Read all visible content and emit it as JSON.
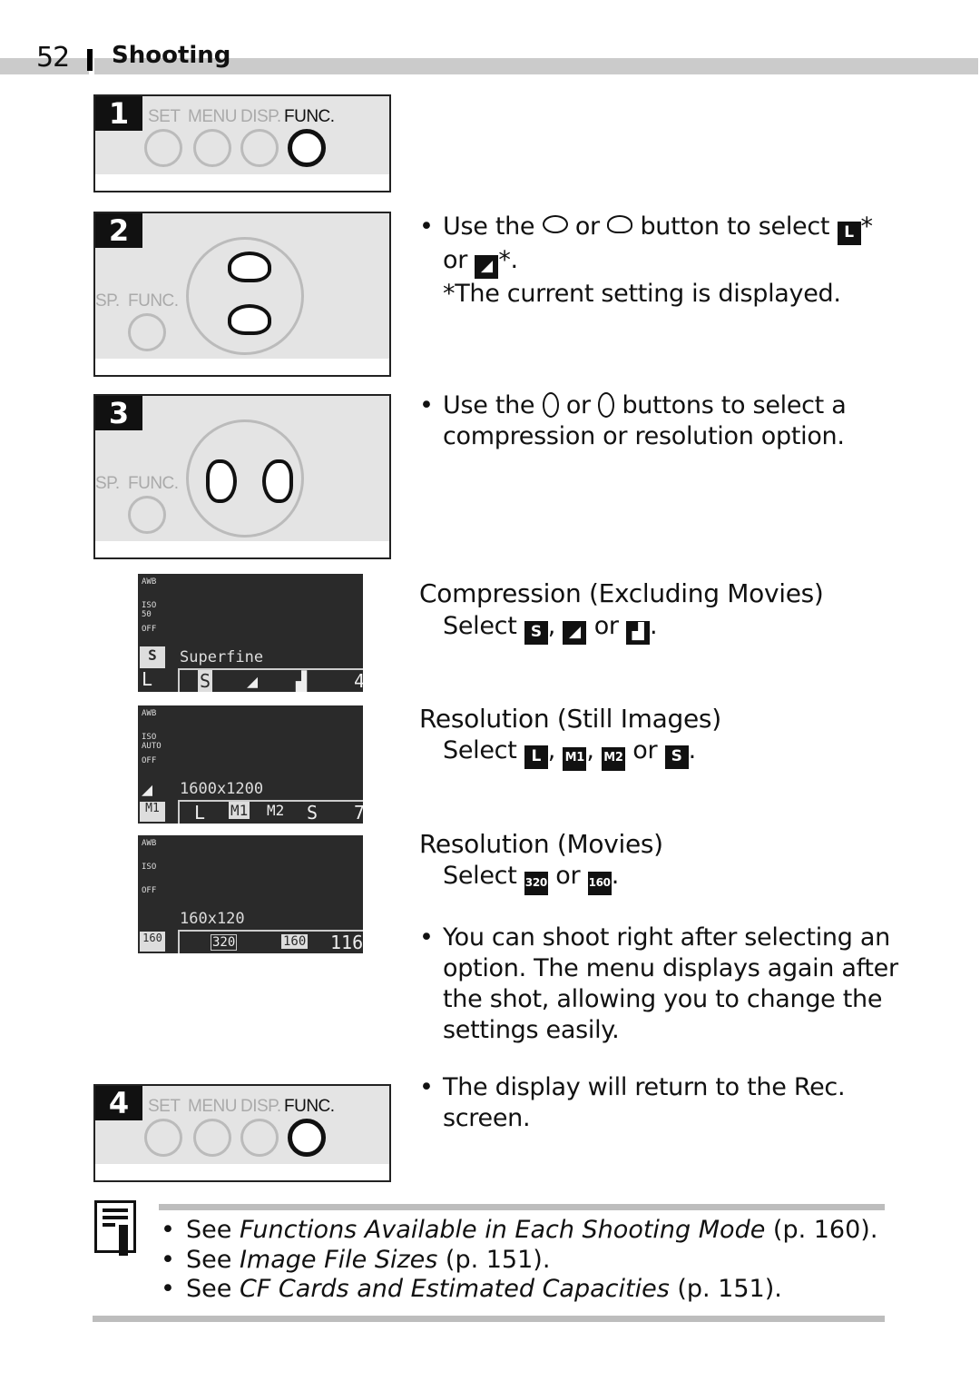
{
  "header": {
    "page_number": "52",
    "section": "Shooting"
  },
  "colors": {
    "header_bar": "#cbcbcb",
    "lcd_bg": "#2a2a2a",
    "text": "#111111"
  },
  "steps": [
    {
      "number": "1",
      "buttons": [
        "SET",
        "MENU",
        "DISP.",
        "FUNC."
      ],
      "active_button": "FUNC."
    },
    {
      "number": "2",
      "labels": [
        "SP.",
        "FUNC."
      ],
      "highlight": "up-down-buttons",
      "text_prefix": "Use the",
      "text_or": "or",
      "text_mid": "button to select",
      "glyph1": "L",
      "star": "*",
      "line2_or": "or",
      "line2_star": "*.",
      "note": "*The current setting is displayed."
    },
    {
      "number": "3",
      "labels": [
        "SP.",
        "FUNC."
      ],
      "highlight": "left-right-buttons",
      "text_prefix": "Use the",
      "text_or": "or",
      "text_rest": "buttons to select a",
      "line2": "compression or resolution option."
    },
    {
      "number": "4",
      "buttons": [
        "SET",
        "MENU",
        "DISP.",
        "FUNC."
      ],
      "active_button": "FUNC.",
      "text_line1": "The display will return to the Rec.",
      "text_line2": "screen."
    }
  ],
  "screens": [
    {
      "left_icons": [
        "AWB",
        "ISO 50",
        "OFF"
      ],
      "caption": "Superfine",
      "corner": "L",
      "options": [
        "S",
        "◢",
        "▟"
      ],
      "count": "4"
    },
    {
      "left_icons": [
        "AWB",
        "ISO AUTO",
        "OFF"
      ],
      "caption": "1600x1200",
      "corner": "M1",
      "options": [
        "L",
        "M1",
        "M2",
        "S"
      ],
      "count": "7"
    },
    {
      "left_icons": [
        "AWB",
        "ISO",
        "OFF"
      ],
      "caption": "160x120",
      "corner": "160",
      "options": [
        "320",
        "160"
      ],
      "count": "116\""
    }
  ],
  "sections": {
    "compression": {
      "heading": "Compression (Excluding Movies)",
      "select": "Select",
      "sep1": ",",
      "or": "or",
      "end": ".",
      "glyphs": [
        "S",
        "◢",
        "▟"
      ]
    },
    "resolution_still": {
      "heading": "Resolution (Still Images)",
      "select": "Select",
      "or": "or",
      "end": ".",
      "glyphs": [
        "L",
        "M1",
        "M2",
        "S"
      ]
    },
    "resolution_movies": {
      "heading": "Resolution (Movies)",
      "select": "Select",
      "or": "or",
      "end": ".",
      "glyphs": [
        "320",
        "160"
      ]
    },
    "shoot_note": [
      "You can shoot right after selecting an",
      "option. The menu displays again after",
      "the shot, allowing you to change the",
      "settings easily."
    ]
  },
  "notes": [
    {
      "prefix": "See ",
      "title": "Functions Available in Each Shooting Mode",
      "ref": " (p. 160)."
    },
    {
      "prefix": "See ",
      "title": "Image File Sizes",
      "ref": " (p. 151)."
    },
    {
      "prefix": "See ",
      "title": "CF Cards and Estimated Capacities",
      "ref": " (p. 151)."
    }
  ],
  "bullet": "•"
}
